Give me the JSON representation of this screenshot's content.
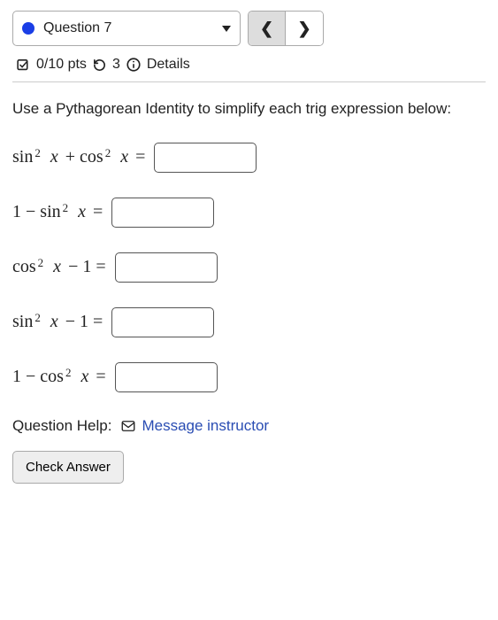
{
  "header": {
    "question_label": "Question 7",
    "points": "0/10 pts",
    "retry_count": "3",
    "details_label": "Details"
  },
  "prompt": "Use a Pythagorean Identity to simplify each trig expression below:",
  "rows": [
    {
      "value": ""
    },
    {
      "value": ""
    },
    {
      "value": ""
    },
    {
      "value": ""
    },
    {
      "value": ""
    }
  ],
  "help": {
    "label": "Question Help:",
    "link": "Message instructor"
  },
  "actions": {
    "check": "Check Answer"
  }
}
